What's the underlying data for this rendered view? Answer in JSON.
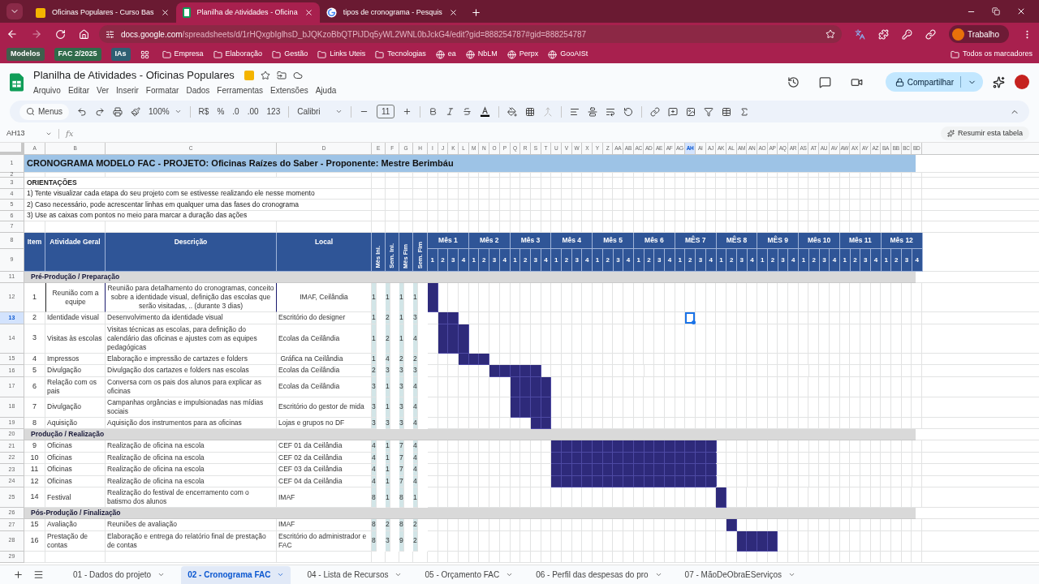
{
  "browser": {
    "tabs": [
      {
        "title": "Oficinas Populares - Curso Bas",
        "selected": false,
        "kind": "slides"
      },
      {
        "title": "Planilha de Atividades - Oficina",
        "selected": true,
        "kind": "sheets"
      },
      {
        "title": "tipos de cronograma - Pesquis",
        "selected": false,
        "kind": "search"
      }
    ],
    "url_host": "docs.google.com",
    "url_path": "/spreadsheets/d/1rHQxgbIglhsD_bJQKzoBbQTPiJDq5yWL2WNL0bJckG4/edit?gid=888254787#gid=888254787",
    "profile": "Trabalho",
    "bookmarks": [
      {
        "label": "Modelos",
        "kind": "chip",
        "color": "#3f5f4c"
      },
      {
        "label": "FAC 2/2025",
        "kind": "chip",
        "color": "#2f6b4a"
      },
      {
        "label": "IAs",
        "kind": "chip",
        "color": "#2e5f73"
      },
      {
        "label": "Empresa",
        "kind": "folder"
      },
      {
        "label": "Elaboração",
        "kind": "folder"
      },
      {
        "label": "Gestão",
        "kind": "folder"
      },
      {
        "label": "Links Uteis",
        "kind": "folder"
      },
      {
        "label": "Tecnologias",
        "kind": "folder"
      },
      {
        "label": "ea",
        "kind": "site"
      },
      {
        "label": "NbLM",
        "kind": "site"
      },
      {
        "label": "Perpx",
        "kind": "site"
      },
      {
        "label": "GooAISt",
        "kind": "site"
      }
    ],
    "all_bookmarks": "Todos os marcadores"
  },
  "sheets": {
    "title": "Planilha de Atividades - Oficinas Populares",
    "menu": [
      "Arquivo",
      "Editar",
      "Ver",
      "Inserir",
      "Formatar",
      "Dados",
      "Ferramentas",
      "Extensões",
      "Ajuda"
    ],
    "share": "Compartilhar",
    "toolbar": {
      "search": "Menus",
      "zoom": "100%",
      "currency": "R$",
      "percent": "%",
      "decrease_decimals": ".0",
      "increase_decimals": ".00",
      "format": "123",
      "font": "Calibri",
      "font_size": "11"
    },
    "name_box": "AH13",
    "formula_label": "fx",
    "summarize": "Resumir esta tabela"
  },
  "sheet": {
    "columns": [
      {
        "label": "A",
        "selected": false
      },
      {
        "label": "B",
        "selected": false
      },
      {
        "label": "C",
        "selected": false
      },
      {
        "label": "D",
        "selected": false
      },
      {
        "label": "E",
        "selected": false
      },
      {
        "label": "F",
        "selected": false
      },
      {
        "label": "G",
        "selected": false
      },
      {
        "label": "H",
        "selected": false
      },
      {
        "label": "I",
        "selected": false
      },
      {
        "label": "J",
        "selected": false
      },
      {
        "label": "K",
        "selected": false
      },
      {
        "label": "L",
        "selected": false
      },
      {
        "label": "M",
        "selected": false
      },
      {
        "label": "N",
        "selected": false
      },
      {
        "label": "O",
        "selected": false
      },
      {
        "label": "P",
        "selected": false
      },
      {
        "label": "Q",
        "selected": false
      },
      {
        "label": "R",
        "selected": false
      },
      {
        "label": "S",
        "selected": false
      },
      {
        "label": "T",
        "selected": false
      },
      {
        "label": "U",
        "selected": false
      },
      {
        "label": "V",
        "selected": false
      },
      {
        "label": "W",
        "selected": false
      },
      {
        "label": "X",
        "selected": false
      },
      {
        "label": "Y",
        "selected": false
      },
      {
        "label": "Z",
        "selected": false
      },
      {
        "label": "AA",
        "selected": false
      },
      {
        "label": "AB",
        "selected": false
      },
      {
        "label": "AC",
        "selected": false
      },
      {
        "label": "AD",
        "selected": false
      },
      {
        "label": "AE",
        "selected": false
      },
      {
        "label": "AF",
        "selected": false
      },
      {
        "label": "AG",
        "selected": false
      },
      {
        "label": "AH",
        "selected": true
      },
      {
        "label": "AI",
        "selected": false
      },
      {
        "label": "AJ",
        "selected": false
      },
      {
        "label": "AK",
        "selected": false
      },
      {
        "label": "AL",
        "selected": false
      },
      {
        "label": "AM",
        "selected": false
      },
      {
        "label": "AN",
        "selected": false
      },
      {
        "label": "AO",
        "selected": false
      },
      {
        "label": "AP",
        "selected": false
      },
      {
        "label": "AQ",
        "selected": false
      },
      {
        "label": "AR",
        "selected": false
      },
      {
        "label": "AS",
        "selected": false
      },
      {
        "label": "AT",
        "selected": false
      },
      {
        "label": "AU",
        "selected": false
      },
      {
        "label": "AV",
        "selected": false
      },
      {
        "label": "AW",
        "selected": false
      },
      {
        "label": "AX",
        "selected": false
      },
      {
        "label": "AY",
        "selected": false
      },
      {
        "label": "AZ",
        "selected": false
      },
      {
        "label": "BA",
        "selected": false
      },
      {
        "label": "BB",
        "selected": false
      },
      {
        "label": "BC",
        "selected": false
      },
      {
        "label": "BD",
        "selected": false
      }
    ],
    "rows": [
      {
        "kind": "title",
        "number": "1",
        "selected": false,
        "text": "CRONOGRAMA MODELO FAC - PROJETO: Oficinas Raízes do Saber - Proponente: Mestre Berimbáu"
      },
      {
        "kind": "spacer",
        "number": "2",
        "selected": false
      },
      {
        "kind": "note_heading",
        "number": "3",
        "selected": false,
        "text": "ORIENTAÇÕES"
      },
      {
        "kind": "note",
        "number": "4",
        "selected": false,
        "text": "1) Tente visualizar cada etapa do seu projeto com se estivesse realizando ele nesse momento"
      },
      {
        "kind": "note",
        "number": "5",
        "selected": false,
        "text": "2) Caso necessário, pode acrescentar linhas em qualquer uma das fases do cronograma"
      },
      {
        "kind": "note",
        "number": "6",
        "selected": false,
        "text": "3) Use as caixas com pontos no meio para marcar a duração das ações"
      },
      {
        "kind": "blank",
        "number": "7",
        "selected": false
      },
      {
        "kind": "header",
        "numbers": [
          "8",
          "9"
        ],
        "item": "Item",
        "activity": "Atividade Geral",
        "description": "Descrição",
        "location": "Local",
        "date_columns": [
          "Mês Ini.",
          "Sem. Ini.",
          "Mês Fim",
          "Sem. Fim"
        ],
        "months": [
          {
            "label": "Mês 1",
            "weeks": [
              "1",
              "2",
              "3",
              "4"
            ]
          },
          {
            "label": "Mês 2",
            "weeks": [
              "1",
              "2",
              "3",
              "4"
            ]
          },
          {
            "label": "Mês 3",
            "weeks": [
              "1",
              "2",
              "3",
              "4"
            ]
          },
          {
            "label": "Mês 4",
            "weeks": [
              "1",
              "2",
              "3",
              "4"
            ]
          },
          {
            "label": "Mês 5",
            "weeks": [
              "1",
              "2",
              "3",
              "4"
            ]
          },
          {
            "label": "Mês 6",
            "weeks": [
              "1",
              "2",
              "3",
              "4"
            ]
          },
          {
            "label": "MÊS 7",
            "weeks": [
              "1",
              "2",
              "3",
              "4"
            ]
          },
          {
            "label": "MÊS 8",
            "weeks": [
              "1",
              "2",
              "3",
              "4"
            ]
          },
          {
            "label": "MÊS 9",
            "weeks": [
              "1",
              "2",
              "3",
              "4"
            ]
          },
          {
            "label": "Mês 10",
            "weeks": [
              "1",
              "2",
              "3",
              "4"
            ]
          },
          {
            "label": "Mês 11",
            "weeks": [
              "1",
              "2",
              "3",
              "4"
            ]
          },
          {
            "label": "Mês 12",
            "weeks": [
              "1",
              "2",
              "3",
              "4"
            ]
          }
        ]
      },
      {
        "kind": "section",
        "number": "11",
        "selected": false,
        "text": "Pré-Produção / Preparação"
      },
      {
        "kind": "task",
        "number": "12",
        "selected": false,
        "emphasized": true,
        "item": "1",
        "activity": "Reunião com a equipe",
        "description": "Reunião para detalhamento do cronogramas, conceito sobre a identidade visual, definição das escolas que serão visitadas, .. (durante 3 dias)",
        "location": "IMAF, Ceilândia",
        "mes_ini": "1",
        "sem_ini": "1",
        "mes_fim": "1",
        "sem_fim": "1"
      },
      {
        "kind": "task",
        "number": "13",
        "selected": true,
        "emphasized": false,
        "item": "2",
        "activity": "Identidade visual",
        "description": "Desenvolvimento da identidade visual",
        "location": "Escritório do designer",
        "mes_ini": "1",
        "sem_ini": "2",
        "mes_fim": "1",
        "sem_fim": "3"
      },
      {
        "kind": "task",
        "number": "14",
        "selected": false,
        "emphasized": false,
        "item": "3",
        "activity": "Visitas às escolas",
        "description": "Visitas técnicas as escolas, para definição do calendário das oficinas e ajustes com as equipes pedagógicas",
        "location": "Ecolas da Ceilândia",
        "mes_ini": "1",
        "sem_ini": "2",
        "mes_fim": "1",
        "sem_fim": "4"
      },
      {
        "kind": "task",
        "number": "15",
        "selected": false,
        "emphasized": false,
        "item": "4",
        "activity": "Impressos",
        "description": "Elaboração e impressão de cartazes e folders",
        "location": " Gráfica na Ceilândia",
        "mes_ini": "1",
        "sem_ini": "4",
        "mes_fim": "2",
        "sem_fim": "2"
      },
      {
        "kind": "task",
        "number": "16",
        "selected": false,
        "emphasized": false,
        "item": "5",
        "activity": "Divulgação",
        "description": "Divulgação dos cartazes e folders nas escolas",
        "location": "Ecolas da Ceilândia",
        "mes_ini": "2",
        "sem_ini": "3",
        "mes_fim": "3",
        "sem_fim": "3"
      },
      {
        "kind": "task",
        "number": "17",
        "selected": false,
        "emphasized": false,
        "item": "6",
        "activity": "Relação com os pais",
        "description": "Conversa com os pais dos alunos para explicar as oficinas",
        "location": "Ecolas da Ceilândia",
        "mes_ini": "3",
        "sem_ini": "1",
        "mes_fim": "3",
        "sem_fim": "4"
      },
      {
        "kind": "task",
        "number": "18",
        "selected": false,
        "emphasized": false,
        "item": "7",
        "activity": "Divulgação",
        "description": "Campanhas orgâncias e impulsionadas nas mídias sociais",
        "location": "Escritório do gestor de mida",
        "mes_ini": "3",
        "sem_ini": "1",
        "mes_fim": "3",
        "sem_fim": "4"
      },
      {
        "kind": "task",
        "number": "19",
        "selected": false,
        "emphasized": false,
        "item": "8",
        "activity": "Aquisição",
        "description": "Aquisição dos instrumentos para as oficinas",
        "location": "Lojas e grupos no DF",
        "mes_ini": "3",
        "sem_ini": "3",
        "mes_fim": "3",
        "sem_fim": "4"
      },
      {
        "kind": "section",
        "number": "20",
        "selected": false,
        "text": "Produção / Realização"
      },
      {
        "kind": "task",
        "number": "21",
        "selected": false,
        "emphasized": false,
        "item": "9",
        "activity": "Oficinas",
        "description": "Realização de oficina na escola",
        "location": "CEF 01 da Ceilândia",
        "mes_ini": "4",
        "sem_ini": "1",
        "mes_fim": "7",
        "sem_fim": "4"
      },
      {
        "kind": "task",
        "number": "22",
        "selected": false,
        "emphasized": false,
        "item": "10",
        "activity": "Oficinas",
        "description": "Realização de oficina na escola",
        "location": "CEF 02 da Ceilândia",
        "mes_ini": "4",
        "sem_ini": "1",
        "mes_fim": "7",
        "sem_fim": "4"
      },
      {
        "kind": "task",
        "number": "23",
        "selected": false,
        "emphasized": false,
        "item": "11",
        "activity": "Oficinas",
        "description": "Realização de oficina na escola",
        "location": "CEF 03 da Ceilândia",
        "mes_ini": "4",
        "sem_ini": "1",
        "mes_fim": "7",
        "sem_fim": "4"
      },
      {
        "kind": "task",
        "number": "24",
        "selected": false,
        "emphasized": false,
        "item": "12",
        "activity": "Oficinas",
        "description": "Realização de oficina na escola",
        "location": "CEF 04 da Ceilândia",
        "mes_ini": "4",
        "sem_ini": "1",
        "mes_fim": "7",
        "sem_fim": "4"
      },
      {
        "kind": "task",
        "number": "25",
        "selected": false,
        "emphasized": false,
        "item": "14",
        "activity": "Festival",
        "description": "Realização do festival de encerramento com o batismo dos alunos",
        "location": "IMAF",
        "mes_ini": "8",
        "sem_ini": "1",
        "mes_fim": "8",
        "sem_fim": "1"
      },
      {
        "kind": "section",
        "number": "26",
        "selected": false,
        "text": "Pós-Produção / Finalização"
      },
      {
        "kind": "task",
        "number": "27",
        "selected": false,
        "emphasized": false,
        "item": "15",
        "activity": "Avaliação",
        "description": "Reuniões de avaliação",
        "location": "IMAF",
        "mes_ini": "8",
        "sem_ini": "2",
        "mes_fim": "8",
        "sem_fim": "2"
      },
      {
        "kind": "task",
        "number": "28",
        "selected": false,
        "emphasized": false,
        "item": "16",
        "activity": "Prestação de contas",
        "description": "Elaboração e entrega do relatório final de prestação de contas",
        "location": "Escritório do administrador e FAC",
        "mes_ini": "8",
        "sem_ini": "3",
        "mes_fim": "9",
        "sem_fim": "2"
      },
      {
        "kind": "blank",
        "number": "29",
        "selected": false
      }
    ]
  },
  "sheet_tabs": [
    {
      "label": "01 - Dados do projeto",
      "selected": false
    },
    {
      "label": "02 - Cronograma FAC",
      "selected": true
    },
    {
      "label": "04 - Lista de Recursos",
      "selected": false
    },
    {
      "label": "05 - Orçamento FAC",
      "selected": false
    },
    {
      "label": "06 - Perfil das despesas do pro",
      "selected": false
    },
    {
      "label": "07 - MãoDeObraEServiços",
      "selected": false
    }
  ]
}
